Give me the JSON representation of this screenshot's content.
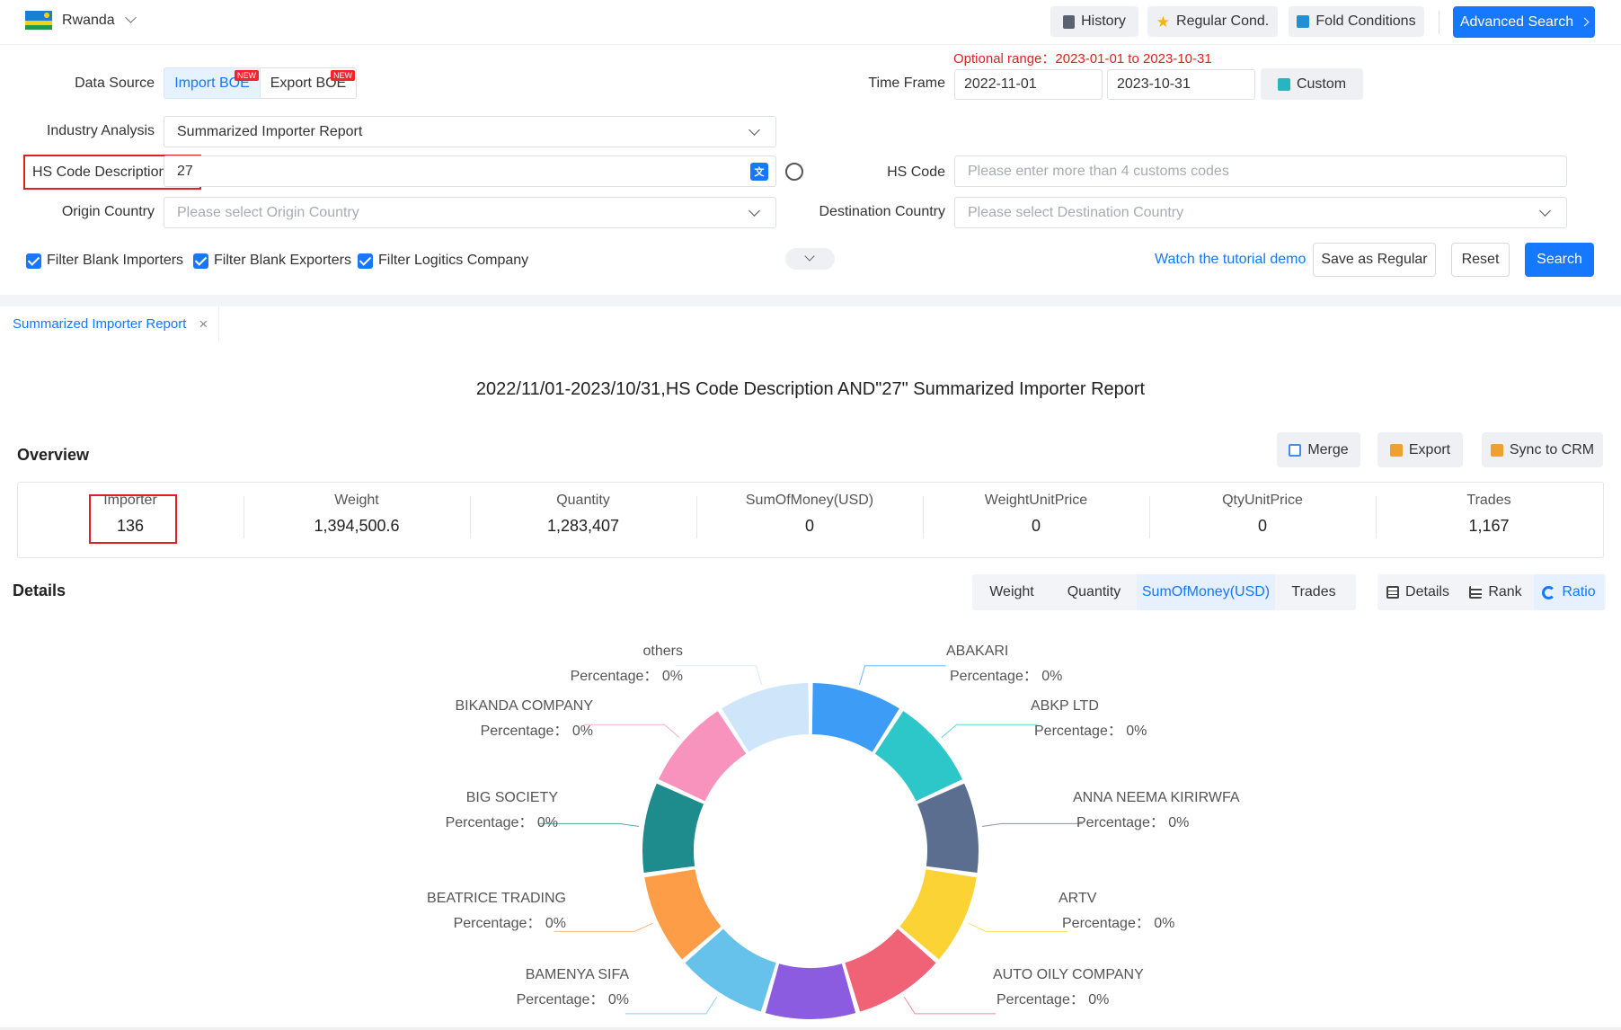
{
  "topbar": {
    "country": "Rwanda",
    "history": "History",
    "regular_cond": "Regular Cond.",
    "fold_conditions": "Fold Conditions",
    "advanced_search": "Advanced Search"
  },
  "form": {
    "optional_range_label": "Optional range：",
    "optional_range_value": "2023-01-01 to 2023-10-31",
    "data_source_label": "Data Source",
    "import_boe": "Import BOE",
    "export_boe": "Export BOE",
    "new_badge": "NEW",
    "time_frame_label": "Time Frame",
    "date_from": "2022-11-01",
    "date_to": "2023-10-31",
    "custom": "Custom",
    "industry_label": "Industry Analysis",
    "industry_value": "Summarized Importer Report",
    "hs_desc_label": "HS Code Description",
    "hs_desc_value": "27",
    "hs_code_label": "HS Code",
    "hs_code_placeholder": "Please enter more than 4 customs codes",
    "origin_label": "Origin Country",
    "origin_placeholder": "Please select Origin Country",
    "dest_label": "Destination Country",
    "dest_placeholder": "Please select Destination Country",
    "filters": [
      "Filter Blank Importers",
      "Filter Blank Exporters",
      "Filter Logitics Company"
    ],
    "tutorial": "Watch the tutorial demo",
    "save_regular": "Save as Regular",
    "reset": "Reset",
    "search": "Search"
  },
  "tab": {
    "label": "Summarized Importer Report"
  },
  "report": {
    "title": "2022/11/01-2023/10/31,HS Code Description AND\"27\" Summarized Importer Report",
    "overview": "Overview",
    "merge": "Merge",
    "export": "Export",
    "sync_crm": "Sync to CRM",
    "stats": [
      {
        "title": "Importer",
        "value": "136"
      },
      {
        "title": "Weight",
        "value": "1,394,500.6"
      },
      {
        "title": "Quantity",
        "value": "1,283,407"
      },
      {
        "title": "SumOfMoney(USD)",
        "value": "0"
      },
      {
        "title": "WeightUnitPrice",
        "value": "0"
      },
      {
        "title": "QtyUnitPrice",
        "value": "0"
      },
      {
        "title": "Trades",
        "value": "1,167"
      }
    ],
    "details": "Details",
    "metric_tabs": [
      "Weight",
      "Quantity",
      "SumOfMoney(USD)",
      "Trades"
    ],
    "active_metric": "SumOfMoney(USD)",
    "view_tabs": [
      "Details",
      "Rank",
      "Ratio"
    ],
    "active_view": "Ratio"
  },
  "chart_data": {
    "type": "pie",
    "style": "donut",
    "percentage_label": "Percentage：",
    "slices": [
      {
        "name": "ABAKARI",
        "percent": "0%",
        "color": "#3d9cf5"
      },
      {
        "name": "ABKP LTD",
        "percent": "0%",
        "color": "#2ec7c9"
      },
      {
        "name": "ANNA NEEMA KIRIRWFA",
        "percent": "0%",
        "color": "#5c6e8f"
      },
      {
        "name": "ARTV",
        "percent": "0%",
        "color": "#fcd335"
      },
      {
        "name": "AUTO OILY COMPANY",
        "percent": "0%",
        "color": "#f06377"
      },
      {
        "name": "",
        "percent": "",
        "color": "#8c5ce0"
      },
      {
        "name": "BAMENYA SIFA",
        "percent": "0%",
        "color": "#66c2ea"
      },
      {
        "name": "BEATRICE TRADING",
        "percent": "0%",
        "color": "#fd9d48"
      },
      {
        "name": "BIG SOCIETY",
        "percent": "0%",
        "color": "#1e8c8c"
      },
      {
        "name": "BIKANDA COMPANY",
        "percent": "0%",
        "color": "#f893be"
      },
      {
        "name": "others",
        "percent": "0%",
        "color": "#cfe5fa"
      }
    ]
  }
}
